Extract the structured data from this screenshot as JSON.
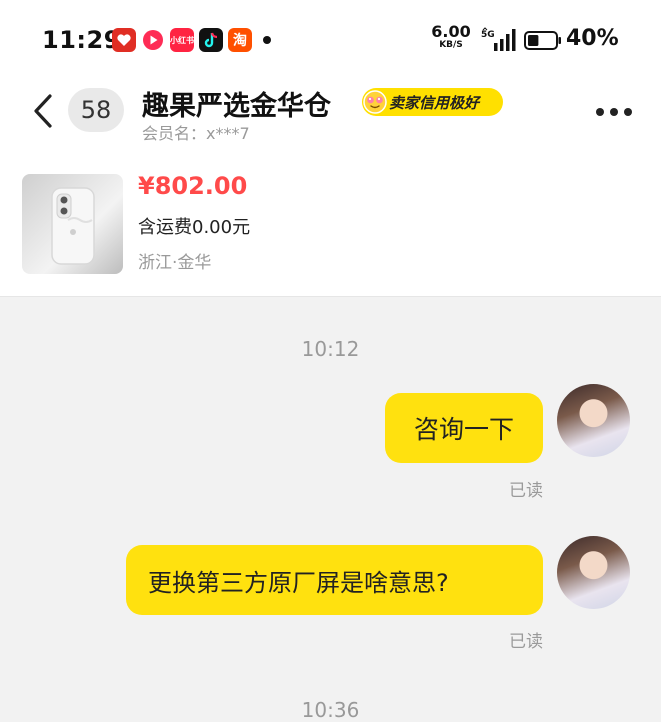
{
  "status_bar": {
    "time": "11:29",
    "app_icons": [
      {
        "name": "pinduoduo-icon",
        "color": "#e02e24"
      },
      {
        "name": "video-app-icon",
        "color": "#fe2c55"
      },
      {
        "name": "xiaohongshu-icon",
        "color": "#ff2442",
        "text": "小红书"
      },
      {
        "name": "douyin-icon",
        "color": "#111111"
      },
      {
        "name": "taobao-icon",
        "color": "#ff5000",
        "text": "淘"
      }
    ],
    "net_speed_value": "6.00",
    "net_speed_unit": "KB/S",
    "network": "5G",
    "battery_level": 0.4,
    "battery_pct": "40%"
  },
  "header": {
    "unread_count": "58",
    "shop_name": "趣果严选金华仓",
    "credit_badge": "卖家信用极好",
    "member_label": "会员名：x***7"
  },
  "product": {
    "price": "¥802.00",
    "shipping": "含运费0.00元",
    "location": "浙江·金华"
  },
  "chat": {
    "timestamps": [
      "10:12",
      "10:36"
    ],
    "messages": [
      {
        "text": "咨询一下",
        "status": "已读"
      },
      {
        "text": "更换第三方原厂屏是啥意思?",
        "status": "已读"
      }
    ]
  },
  "colors": {
    "accent": "#ffe10f",
    "price": "#ff4a4a",
    "muted": "#9a9a9a"
  }
}
